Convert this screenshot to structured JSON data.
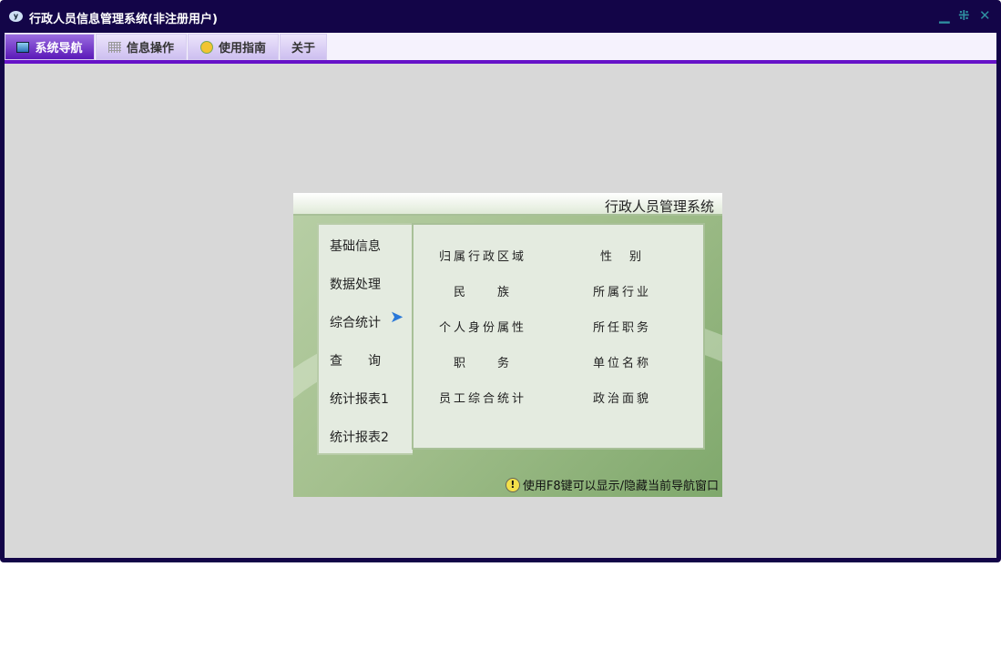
{
  "window": {
    "title": "行政人员信息管理系统(非注册用户)",
    "logo": "y"
  },
  "tabs": [
    {
      "label": "系统导航",
      "icon": "monitor-icon"
    },
    {
      "label": "信息操作",
      "icon": "grid-icon"
    },
    {
      "label": "使用指南",
      "icon": "help-icon"
    },
    {
      "label": "关于"
    }
  ],
  "panel": {
    "title": "行政人员管理系统",
    "menu": [
      "基础信息",
      "数据处理",
      "综合统计",
      "查　　询",
      "统计报表1",
      "统计报表2"
    ],
    "items": [
      "归属行政区域",
      "性　别",
      "民　　族",
      "所属行业",
      "个人身份属性",
      "所任职务",
      "职　　务",
      "单位名称",
      "员工综合统计",
      "政治面貌"
    ],
    "hint": "使用F8键可以显示/隐藏当前导航窗口"
  }
}
